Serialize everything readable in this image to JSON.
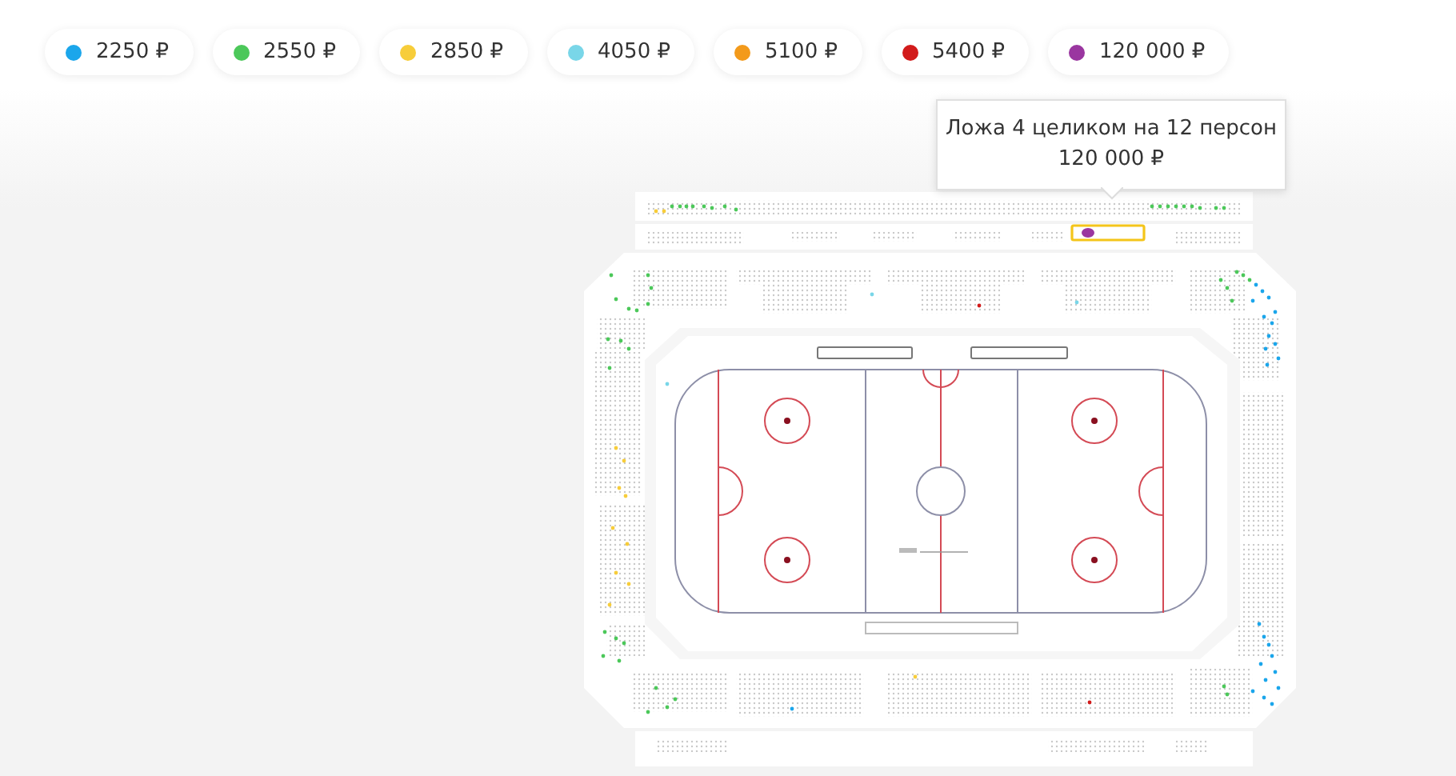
{
  "price_legend": [
    {
      "price": "2250 ₽",
      "color": "#1ba6eb"
    },
    {
      "price": "2550 ₽",
      "color": "#4cc85a"
    },
    {
      "price": "2850 ₽",
      "color": "#f7cd3a"
    },
    {
      "price": "4050 ₽",
      "color": "#79d6e8"
    },
    {
      "price": "5100 ₽",
      "color": "#f39a1b"
    },
    {
      "price": "5400 ₽",
      "color": "#d21b1b"
    },
    {
      "price": "120 000 ₽",
      "color": "#9a36a0"
    }
  ],
  "tooltip": {
    "title": "Ложа 4 целиком на 12 персон",
    "price": "120 000 ₽"
  }
}
